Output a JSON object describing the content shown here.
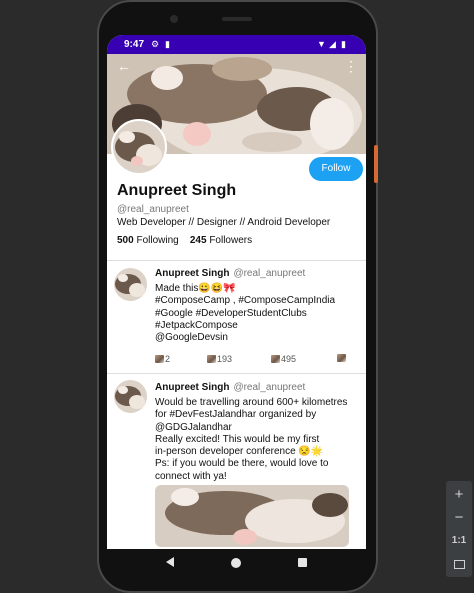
{
  "status_bar": {
    "time": "9:47",
    "icons": [
      "settings-icon",
      "sim-icon",
      "wifi-icon",
      "signal-icon",
      "battery-icon"
    ]
  },
  "toolbar": {
    "back_icon": "arrow-back-icon",
    "menu_icon": "more-vert-icon"
  },
  "profile": {
    "name": "Anupreet Singh",
    "handle": "@real_anupreet",
    "bio": "Web Developer // Designer // Android Developer",
    "following_count": "500",
    "following_label": "Following",
    "followers_count": "245",
    "followers_label": "Followers",
    "follow_button": "Follow"
  },
  "tweets": [
    {
      "name": "Anupreet Singh",
      "handle": "@real_anupreet",
      "lines": [
        "Made this😀😆🎀",
        "#ComposeCamp , #ComposeCampIndia",
        "#Google #DeveloperStudentClubs",
        "#JetpackCompose",
        "@GoogleDevsin"
      ],
      "actions": [
        "2",
        "193",
        "495",
        ""
      ]
    },
    {
      "name": "Anupreet Singh",
      "handle": "@real_anupreet",
      "lines": [
        "Would be travelling around 600+ kilometres",
        "for #DevFestJalandhar organized by",
        "@GDGJalandhar",
        "Really excited! This would be my first",
        "in-person developer conference 😒🌟",
        "Ps: if you would be there, would love to",
        "connect with ya!"
      ]
    }
  ],
  "emulator_controls": [
    "+",
    "−",
    "1:1",
    ""
  ],
  "colors": {
    "status_bar": "#3700b3",
    "follow_button": "#1da1f2",
    "side_button": "#d56a33"
  }
}
